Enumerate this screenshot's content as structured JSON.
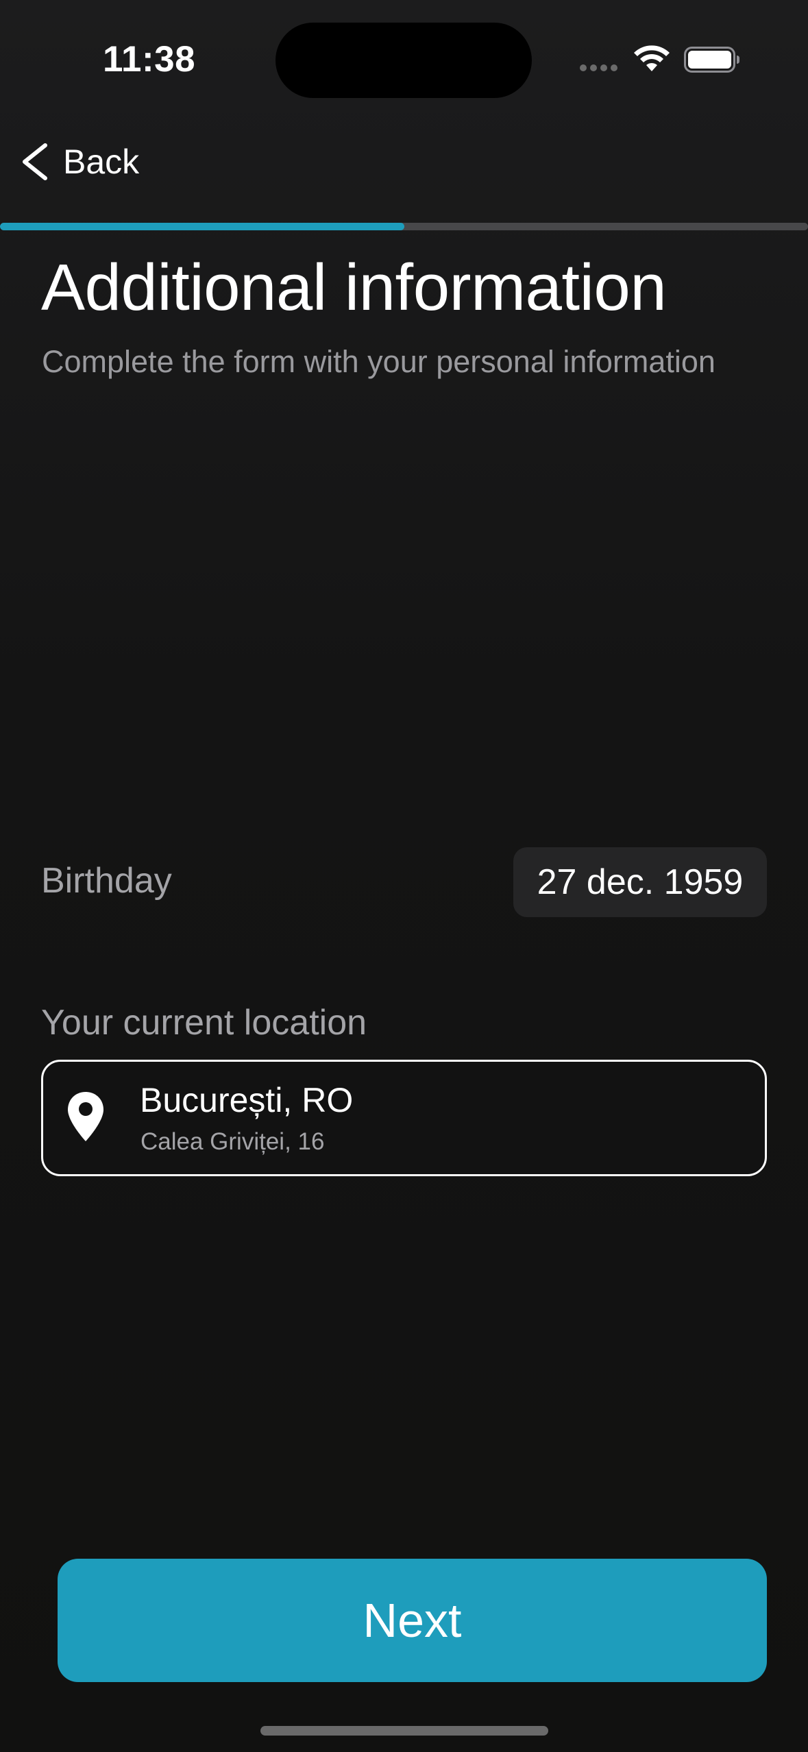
{
  "status_bar": {
    "time": "11:38",
    "icons": [
      "signal-dots-icon",
      "wifi-icon",
      "battery-icon"
    ]
  },
  "nav": {
    "back_label": "Back",
    "back_icon": "chevron-left-icon"
  },
  "progress": {
    "value": 0.5,
    "fill_color": "#1E9DBC",
    "track_color": "#48484A"
  },
  "header": {
    "title": "Additional information",
    "subtitle": "Complete the form with your personal information"
  },
  "birthday": {
    "label": "Birthday",
    "value": "27 dec. 1959"
  },
  "location": {
    "label": "Your current location",
    "icon": "map-pin-icon",
    "city": "București, RO",
    "street": "Calea Griviței, 16"
  },
  "actions": {
    "next_label": "Next"
  },
  "colors": {
    "accent": "#1E9DBC",
    "background": "#141414",
    "muted_text": "#A4A4A8"
  }
}
